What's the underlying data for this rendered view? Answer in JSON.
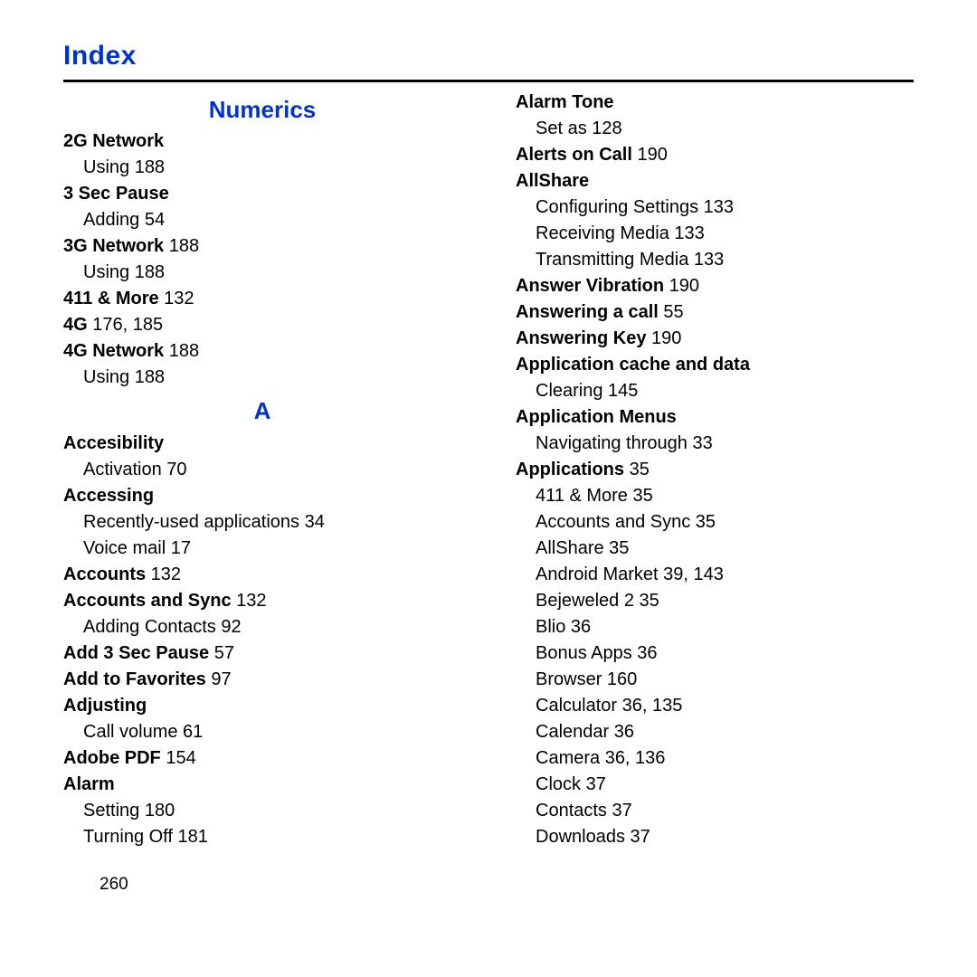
{
  "title": "Index",
  "pageNumber": "260",
  "col1": {
    "sectionNumerics": "Numerics",
    "e": [
      {
        "t": "2G Network",
        "cls": "topic"
      },
      {
        "t": "Using 188",
        "cls": "sub"
      },
      {
        "t": "3 Sec Pause",
        "cls": "topic"
      },
      {
        "t": "Adding 54",
        "cls": "sub"
      },
      {
        "t": "3G Network 188",
        "cls": "topic"
      },
      {
        "t": "Using 188",
        "cls": "sub"
      },
      {
        "t": "411 & More 132",
        "cls": "topic"
      },
      {
        "t": "4G 176, 185",
        "cls": "topic"
      },
      {
        "t": "4G Network 188",
        "cls": "topic"
      },
      {
        "t": "Using 188",
        "cls": "sub"
      }
    ],
    "sectionA": "A",
    "e2": [
      {
        "t": "Accesibility",
        "cls": "topic"
      },
      {
        "t": "Activation 70",
        "cls": "sub"
      },
      {
        "t": "Accessing",
        "cls": "topic"
      },
      {
        "t": "Recently-used applications 34",
        "cls": "sub"
      },
      {
        "t": "Voice mail 17",
        "cls": "sub"
      },
      {
        "t": "Accounts 132",
        "cls": "topic"
      },
      {
        "t": "Accounts and Sync 132",
        "cls": "topic"
      },
      {
        "t": "Adding Contacts 92",
        "cls": "sub"
      },
      {
        "t": "Add 3 Sec Pause 57",
        "cls": "topic"
      },
      {
        "t": "Add to Favorites 97",
        "cls": "topic"
      },
      {
        "t": "Adjusting",
        "cls": "topic"
      },
      {
        "t": "Call volume 61",
        "cls": "sub"
      },
      {
        "t": "Adobe PDF 154",
        "cls": "topic"
      },
      {
        "t": "Alarm",
        "cls": "topic"
      },
      {
        "t": "Setting 180",
        "cls": "sub"
      },
      {
        "t": "Turning Off 181",
        "cls": "sub"
      }
    ]
  },
  "col2": {
    "e": [
      {
        "t": "Alarm Tone",
        "cls": "topic"
      },
      {
        "t": "Set as 128",
        "cls": "sub"
      },
      {
        "t": "Alerts on Call 190",
        "cls": "topic"
      },
      {
        "t": "AllShare",
        "cls": "topic"
      },
      {
        "t": "Configuring Settings 133",
        "cls": "sub"
      },
      {
        "t": "Receiving Media 133",
        "cls": "sub"
      },
      {
        "t": "Transmitting Media 133",
        "cls": "sub"
      },
      {
        "t": "Answer Vibration 190",
        "cls": "topic"
      },
      {
        "t": "Answering a call 55",
        "cls": "topic"
      },
      {
        "t": "Answering Key 190",
        "cls": "topic"
      },
      {
        "t": "Application cache and data",
        "cls": "topic"
      },
      {
        "t": "Clearing 145",
        "cls": "sub"
      },
      {
        "t": "Application Menus",
        "cls": "topic"
      },
      {
        "t": "Navigating through 33",
        "cls": "sub"
      },
      {
        "t": "Applications 35",
        "cls": "topic"
      },
      {
        "t": "411 & More 35",
        "cls": "sub"
      },
      {
        "t": "Accounts and Sync 35",
        "cls": "sub"
      },
      {
        "t": "AllShare 35",
        "cls": "sub"
      },
      {
        "t": "Android Market 39, 143",
        "cls": "sub"
      },
      {
        "t": "Bejeweled 2 35",
        "cls": "sub"
      },
      {
        "t": "Blio 36",
        "cls": "sub"
      },
      {
        "t": "Bonus Apps 36",
        "cls": "sub"
      },
      {
        "t": "Browser 160",
        "cls": "sub"
      },
      {
        "t": "Calculator 36, 135",
        "cls": "sub"
      },
      {
        "t": "Calendar 36",
        "cls": "sub"
      },
      {
        "t": "Camera 36, 136",
        "cls": "sub"
      },
      {
        "t": "Clock 37",
        "cls": "sub"
      },
      {
        "t": "Contacts 37",
        "cls": "sub"
      },
      {
        "t": "Downloads 37",
        "cls": "sub"
      }
    ]
  }
}
